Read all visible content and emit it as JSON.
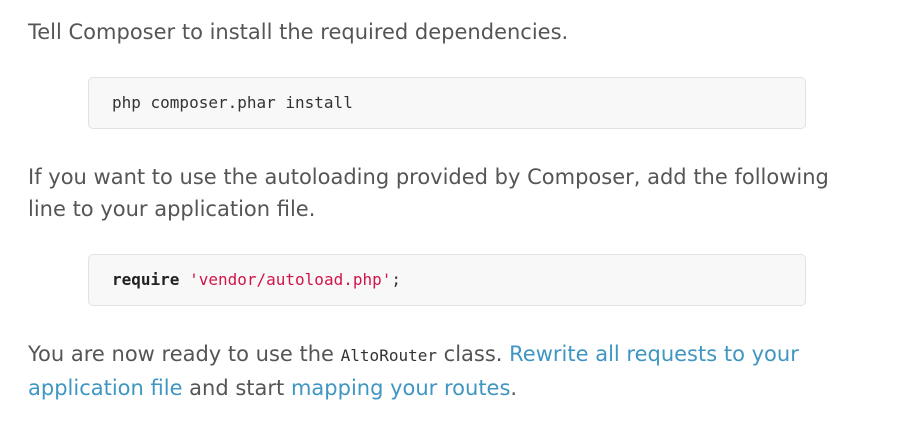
{
  "step1": {
    "text": "Tell Composer to install the required dependencies.",
    "code": "php composer.phar install"
  },
  "step2": {
    "text": "If you want to use the autoloading provided by Composer, add the following line to your application file.",
    "code_keyword": "require",
    "code_string": "'vendor/autoload.php'",
    "code_end": ";"
  },
  "step3": {
    "text_before": "You are now ready to use the ",
    "inline_code": "AltoRouter",
    "text_mid": " class. ",
    "link1": "Rewrite all requests to your application file",
    "text_and": " and start ",
    "link2": "mapping your routes",
    "text_end": "."
  },
  "colors": {
    "body_text": "#555555",
    "link": "#3f96c2",
    "code_bg": "#f8f8f8",
    "code_border": "#e2e2e2",
    "string": "#d0154a"
  }
}
